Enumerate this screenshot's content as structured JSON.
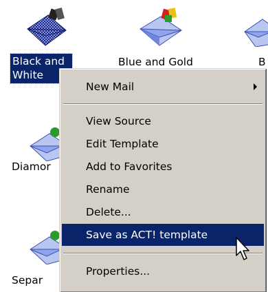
{
  "desktop": {
    "icons": [
      {
        "label_line1": "Black and",
        "label_line2": "White",
        "icon": "envelope-chequered-icon"
      },
      {
        "label": "Blue and Gold",
        "icon": "envelope-gold-icon"
      },
      {
        "label": "B",
        "icon": "envelope-icon"
      },
      {
        "label": "Diamor",
        "icon": "envelope-diamond-icon"
      },
      {
        "label": "Separ",
        "icon": "envelope-icon"
      }
    ]
  },
  "context_menu": {
    "items": [
      {
        "label": "New Mail",
        "has_submenu": true
      },
      {
        "label": "View Source"
      },
      {
        "label": "Edit Template"
      },
      {
        "label": "Add to Favorites"
      },
      {
        "label": "Rename"
      },
      {
        "label": "Delete..."
      },
      {
        "label": "Save as ACT! template",
        "highlighted": true
      },
      {
        "label": "Properties..."
      }
    ]
  },
  "colors": {
    "menu_bg": "#d4d0c8",
    "highlight": "#0a246a",
    "highlight_text": "#ffffff"
  }
}
